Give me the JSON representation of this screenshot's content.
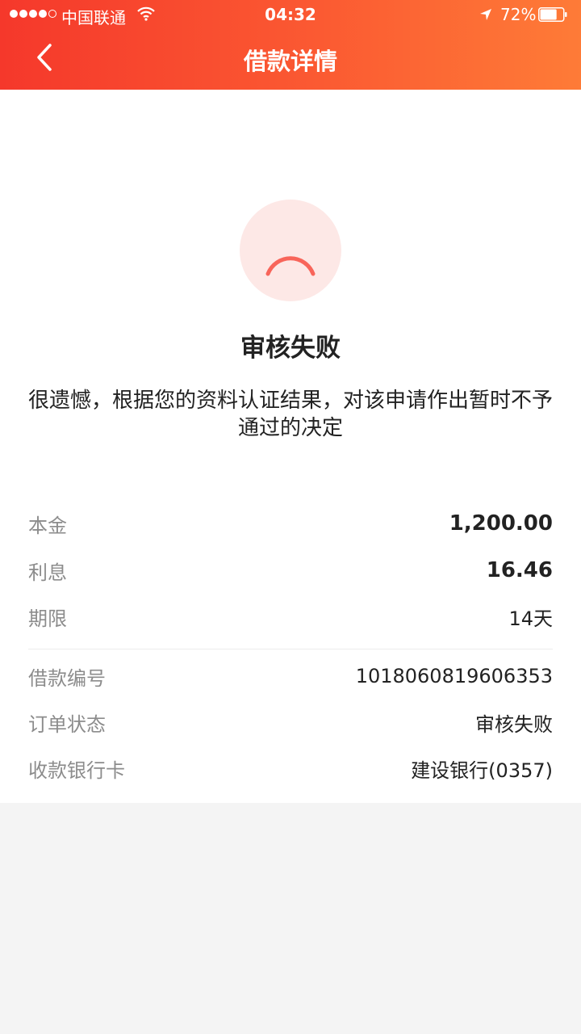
{
  "status_bar": {
    "carrier": "中国联通",
    "time": "04:32",
    "battery_percent": "72%",
    "battery_level": 0.72
  },
  "nav": {
    "title": "借款详情",
    "back_icon": "chevron-left-icon"
  },
  "result": {
    "icon": "sad-face-icon",
    "title": "审核失败",
    "message": "很遗憾，根据您的资料认证结果，对该申请作出暂时不予通过的决定"
  },
  "loan": {
    "principal": {
      "label": "本金",
      "value": "1,200.00"
    },
    "interest": {
      "label": "利息",
      "value": "16.46"
    },
    "term": {
      "label": "期限",
      "value": "14天"
    }
  },
  "order": {
    "number": {
      "label": "借款编号",
      "value": "1018060819606353"
    },
    "status": {
      "label": "订单状态",
      "value": "审核失败"
    },
    "bank_card": {
      "label": "收款银行卡",
      "value": "建设银行(0357)"
    }
  },
  "colors": {
    "header_start": "#f5382b",
    "header_end": "#fe7b37",
    "icon_bg": "#fde8e6",
    "icon_stroke": "#f8655a",
    "label_gray": "#8c8c8c"
  }
}
